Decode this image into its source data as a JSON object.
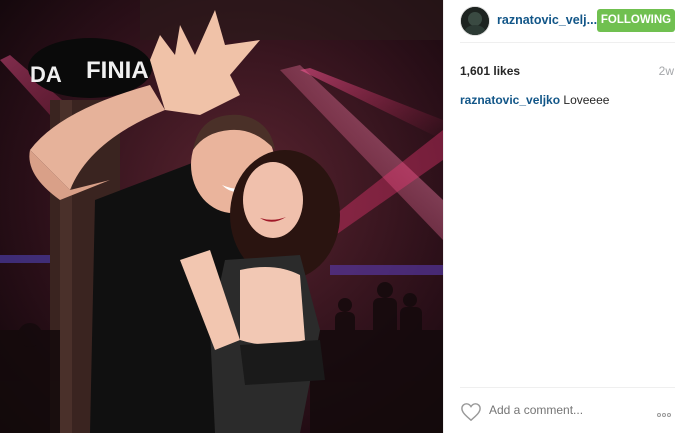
{
  "post": {
    "username": "raznatovic_velj...",
    "follow_label": "FOLLOWING",
    "likes": "1,601 likes",
    "timestamp": "2w",
    "caption_user": "raznatovic_veljko",
    "caption_text": " Loveeee",
    "comment_placeholder": "Add a comment..."
  },
  "photo": {
    "sign_text": "FINIA",
    "sign_text_left": "DA"
  },
  "colors": {
    "username": "#125688",
    "follow_button": "#70c050",
    "muted": "#a5a7aa"
  },
  "icons": [
    "avatar",
    "heart-icon",
    "more-options-icon"
  ]
}
